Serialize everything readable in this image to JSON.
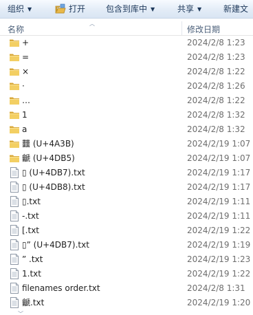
{
  "toolbar": {
    "organize": "组织",
    "open": "打开",
    "include_in_library": "包含到库中",
    "share": "共享",
    "new_folder": "新建文"
  },
  "columns": {
    "name": "名称",
    "date_modified": "修改日期"
  },
  "files": [
    {
      "name": "+",
      "date": "2024/2/8 1:23",
      "type": "folder"
    },
    {
      "name": "=",
      "date": "2024/2/8 1:23",
      "type": "folder"
    },
    {
      "name": "×",
      "date": "2024/2/8 1:22",
      "type": "folder"
    },
    {
      "name": "·",
      "date": "2024/2/8 1:26",
      "type": "folder"
    },
    {
      "name": "…",
      "date": "2024/2/8 1:22",
      "type": "folder"
    },
    {
      "name": "1",
      "date": "2024/2/8 1:32",
      "type": "folder"
    },
    {
      "name": "a",
      "date": "2024/2/8 1:32",
      "type": "folder"
    },
    {
      "name": "䨻 (U+4A3B)",
      "date": "2024/2/19 1:07",
      "type": "folder"
    },
    {
      "name": "䶵 (U+4DB5)",
      "date": "2024/2/19 1:07",
      "type": "folder"
    },
    {
      "name": "▯ (U+4DB7).txt",
      "date": "2024/2/19 1:17",
      "type": "text-file"
    },
    {
      "name": "▯ (U+4DB8).txt",
      "date": "2024/2/19 1:17",
      "type": "text-file"
    },
    {
      "name": "▯.txt",
      "date": "2024/2/19 1:11",
      "type": "text-file"
    },
    {
      "name": "-.txt",
      "date": "2024/2/19 1:11",
      "type": "text-file"
    },
    {
      "name": "[.txt",
      "date": "2024/2/19 1:22",
      "type": "text-file"
    },
    {
      "name": "▯”  (U+4DB7).txt",
      "date": "2024/2/19 1:19",
      "type": "text-file"
    },
    {
      "name": "” .txt",
      "date": "2024/2/19 1:23",
      "type": "text-file"
    },
    {
      "name": "1.txt",
      "date": "2024/2/19 1:22",
      "type": "text-file"
    },
    {
      "name": "filenames order.txt",
      "date": "2024/2/8 1:31",
      "type": "text-file"
    },
    {
      "name": "䶵.txt",
      "date": "2024/2/19 1:20",
      "type": "text-file"
    }
  ],
  "icons": {
    "folder": "folder-icon",
    "text_file": "text-file-icon",
    "open": "open-icon"
  },
  "colors": {
    "toolbar_text": "#1e395b",
    "header_text": "#4c607a",
    "date_text": "#6d6d6d",
    "folder_yellow": "#f0c657"
  }
}
